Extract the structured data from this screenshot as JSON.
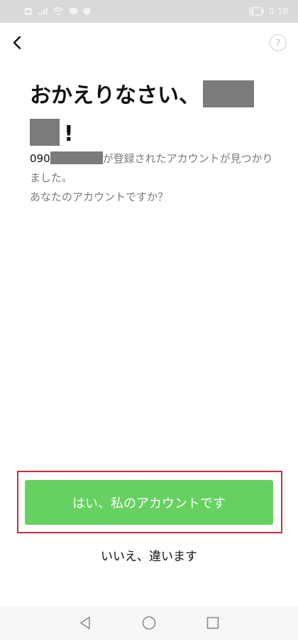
{
  "status_bar": {
    "time": "0:18",
    "icons": [
      "sim-icon",
      "signal-icon",
      "wifi-icon",
      "chat-icon",
      "shield-icon",
      "battery-icon"
    ]
  },
  "header": {
    "back_icon": "chevron-left-icon",
    "help_label": "?"
  },
  "headline": {
    "greeting": "おかえりなさい、",
    "exclaim": "!"
  },
  "description": {
    "phone_prefix": "090",
    "line1_rest": "が登録されたアカウントが見つかりました。",
    "line2": "あなたのアカウントですか？"
  },
  "actions": {
    "confirm_label": "はい、私のアカウントです",
    "deny_label": "いいえ、違います"
  },
  "colors": {
    "primary": "#66d160",
    "highlight": "#d22a3a",
    "status_bar": "#d9d9d9"
  },
  "nav_bar": {
    "icons": [
      "back-triangle-icon",
      "home-circle-icon",
      "recents-square-icon"
    ]
  }
}
